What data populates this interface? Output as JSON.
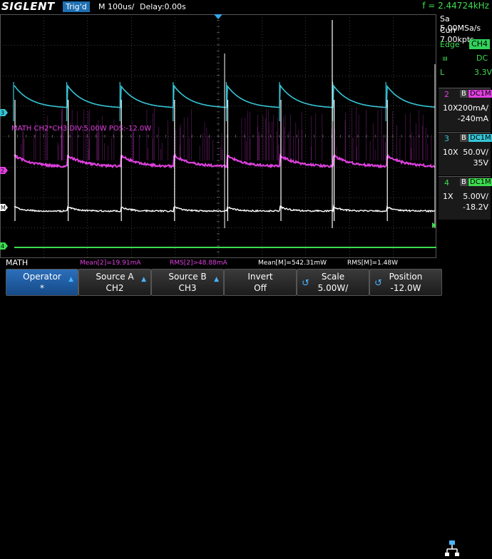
{
  "header": {
    "brand": "SIGLENT",
    "trigger_status": "Trig'd",
    "timebase": "M 100us/",
    "delay": "Delay:0.00s",
    "frequency": "f = 2.44724kHz"
  },
  "acquisition": {
    "sample_rate": "Sa 5.00MSa/s",
    "memory": "Curr 7.00kpts"
  },
  "trigger": {
    "type": "Edge",
    "source": "CH4",
    "coupling": "DC",
    "level_label": "L",
    "level": "3.3V"
  },
  "channels": [
    {
      "num": "2",
      "bw": "B",
      "coupling": "DC1M",
      "probe": "10X",
      "scale": "200mA/",
      "offset": "-240mA",
      "color": "#e040e0"
    },
    {
      "num": "3",
      "bw": "B",
      "coupling": "DC1M",
      "probe": "10X",
      "scale": "50.0V/",
      "offset": "35V",
      "color": "#36c5d6"
    },
    {
      "num": "4",
      "bw": "B",
      "coupling": "DC1M",
      "probe": "1X",
      "scale": "5.00V/",
      "offset": "-18.2V",
      "color": "#3ddc4f"
    }
  ],
  "math_overlay": "MATH  CH2*CH3  DIV:5.00W  POS:-12.0W",
  "markers": {
    "ch3": "3",
    "ch2": "2",
    "math": "M",
    "ch4": "4"
  },
  "measurements": {
    "mean2": "Mean[2]=19.91mA",
    "rms2": "RMS[2]>48.88mA",
    "meanM": "Mean[M]=542.31mW",
    "rmsM": "RMS[M]=1.48W"
  },
  "menu": {
    "title": "MATH",
    "items": [
      {
        "line1": "Operator",
        "line2": "*"
      },
      {
        "line1": "Source A",
        "line2": "CH2"
      },
      {
        "line1": "Source B",
        "line2": "CH3"
      },
      {
        "line1": "Invert",
        "line2": "Off"
      },
      {
        "line1": "Scale",
        "line2": "5.00W/"
      },
      {
        "line1": "Position",
        "line2": "-12.0W"
      }
    ]
  },
  "colors": {
    "ch2": "#e040e0",
    "ch3": "#36c5d6",
    "ch4": "#3ddc4f",
    "math": "#ffffff",
    "grid": "#3a3a3a",
    "accent": "#1f6fb2"
  }
}
